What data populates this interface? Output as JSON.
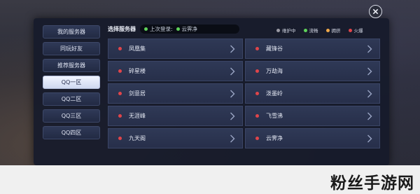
{
  "sidebar": {
    "items": [
      {
        "label": "我的服务器",
        "active": false
      },
      {
        "label": "同玩好友",
        "active": false
      },
      {
        "label": "推荐服务器",
        "active": false
      },
      {
        "label": "QQ一区",
        "active": true
      },
      {
        "label": "QQ二区",
        "active": false
      },
      {
        "label": "QQ三区",
        "active": false
      },
      {
        "label": "QQ四区",
        "active": false
      }
    ]
  },
  "header": {
    "title": "选择服务器",
    "last_login_label": "上次登录:",
    "last_login_server": "云霁净"
  },
  "legend": [
    {
      "label": "维护中",
      "color": "#9a9aa4"
    },
    {
      "label": "流畅",
      "color": "#5fd35a"
    },
    {
      "label": "拥挤",
      "color": "#f0a94a"
    },
    {
      "label": "火爆",
      "color": "#e0454a"
    }
  ],
  "servers": [
    {
      "name": "凤凰集",
      "status_color": "#e0454a"
    },
    {
      "name": "藏锋谷",
      "status_color": "#e0454a"
    },
    {
      "name": "碎星楼",
      "status_color": "#e0454a"
    },
    {
      "name": "万劫海",
      "status_color": "#e0454a"
    },
    {
      "name": "剑意居",
      "status_color": "#e0454a"
    },
    {
      "name": "泼墨岭",
      "status_color": "#e0454a"
    },
    {
      "name": "无涯峰",
      "status_color": "#e0454a"
    },
    {
      "name": "飞雪沸",
      "status_color": "#e0454a"
    },
    {
      "name": "九天阁",
      "status_color": "#e0454a"
    },
    {
      "name": "云霁净",
      "status_color": "#e0454a"
    }
  ],
  "watermark": "粉丝手游网"
}
